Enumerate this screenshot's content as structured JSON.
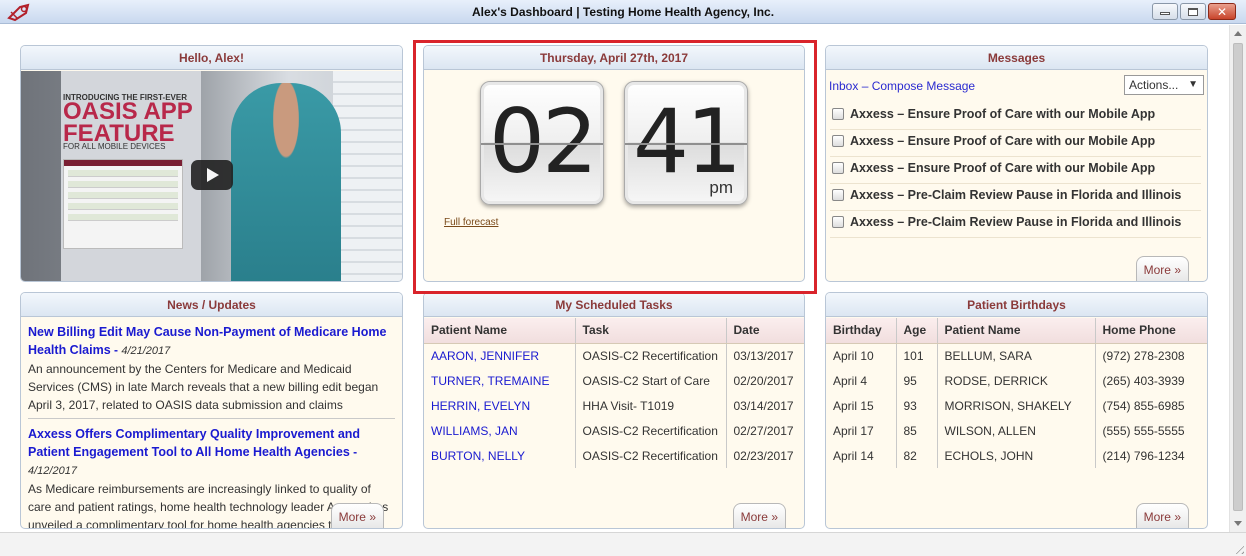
{
  "window": {
    "title": "Alex's Dashboard | Testing Home Health Agency, Inc."
  },
  "hello": {
    "heading": "Hello, Alex!",
    "video": {
      "promo_line1": "INTRODUCING THE FIRST-EVER",
      "promo_line2": "OASIS APP FEATURE",
      "promo_line3": "FOR ALL MOBILE DEVICES"
    }
  },
  "clock": {
    "date": "Thursday, April 27th, 2017",
    "hour": "02",
    "minute": "41",
    "ampm": "pm",
    "forecast_link": "Full forecast"
  },
  "messages": {
    "heading": "Messages",
    "inbox_label": "Inbox",
    "separator": " – ",
    "compose_label": "Compose Message",
    "actions_label": "Actions...",
    "items": [
      "Axxess – Ensure Proof of Care with our Mobile App",
      "Axxess – Ensure Proof of Care with our Mobile App",
      "Axxess – Ensure Proof of Care with our Mobile App",
      "Axxess – Pre-Claim Review Pause in Florida and Illinois",
      "Axxess – Pre-Claim Review Pause in Florida and Illinois"
    ],
    "more_label": "More »"
  },
  "news": {
    "heading": "News / Updates",
    "items": [
      {
        "title": "New Billing Edit May Cause Non-Payment of Medicare Home Health Claims",
        "separator": " - ",
        "date": "4/21/2017",
        "text": "An announcement by the Centers for Medicare and Medicaid Services (CMS) in late March reveals that a new billing edit began April 3, 2017, related to OASIS data submission and claims"
      },
      {
        "title": "Axxess Offers Complimentary Quality Improvement and Patient Engagement Tool to All Home Health Agencies",
        "separator": " - ",
        "date": "4/12/2017",
        "text": "As Medicare reimbursements are increasingly linked to quality of care and patient ratings, home health technology leader Axxess has unveiled a complimentary tool for home health agencies to"
      }
    ],
    "more_label": "More »"
  },
  "tasks": {
    "heading": "My Scheduled Tasks",
    "columns": [
      "Patient Name",
      "Task",
      "Date"
    ],
    "rows": [
      [
        "AARON, JENNIFER",
        "OASIS-C2 Recertification",
        "03/13/2017"
      ],
      [
        "TURNER, TREMAINE",
        "OASIS-C2 Start of Care",
        "02/20/2017"
      ],
      [
        "HERRIN, EVELYN",
        "HHA Visit- T1019",
        "03/14/2017"
      ],
      [
        "WILLIAMS, JAN",
        "OASIS-C2 Recertification",
        "02/27/2017"
      ],
      [
        "BURTON, NELLY",
        "OASIS-C2 Recertification",
        "02/23/2017"
      ]
    ],
    "more_label": "More »"
  },
  "birthdays": {
    "heading": "Patient Birthdays",
    "columns": [
      "Birthday",
      "Age",
      "Patient Name",
      "Home Phone"
    ],
    "rows": [
      [
        "April 10",
        "101",
        "BELLUM, SARA",
        "(972) 278-2308"
      ],
      [
        "April 4",
        "95",
        "RODSE, DERRICK",
        "(265) 403-3939"
      ],
      [
        "April 15",
        "93",
        "MORRISON, SHAKELY",
        "(754) 855-6985"
      ],
      [
        "April 17",
        "85",
        "WILSON, ALLEN",
        "(555) 555-5555"
      ],
      [
        "April 14",
        "82",
        "ECHOLS, JOHN",
        "(214) 796-1234"
      ]
    ],
    "more_label": "More »"
  },
  "colors": {
    "widget_heading": "#8a3a3a",
    "link": "#1a1ad0",
    "widget_background": "#fffaee",
    "highlight": "#d9242b"
  }
}
